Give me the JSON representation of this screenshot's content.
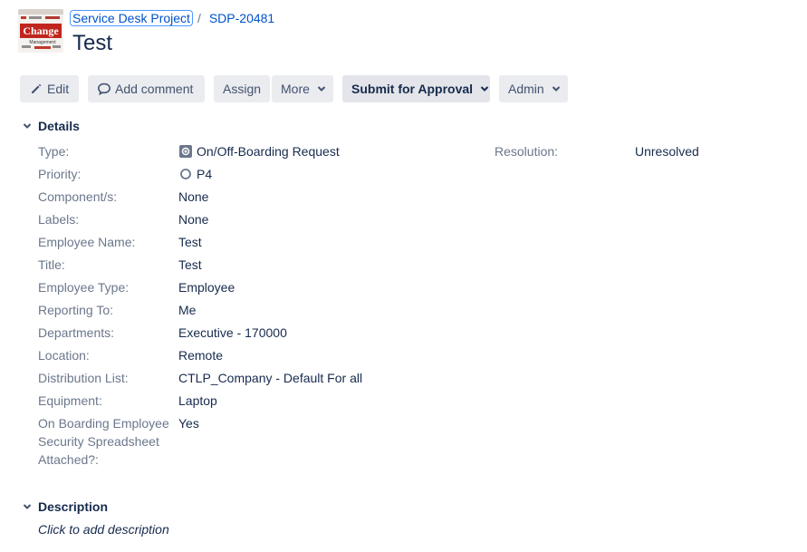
{
  "breadcrumb": {
    "project": "Service Desk Project",
    "separator": "/",
    "issue_key": "SDP-20481"
  },
  "issue": {
    "title": "Test"
  },
  "project_avatar": {
    "text_top": "Change",
    "text_bottom": "Management"
  },
  "toolbar": {
    "edit": "Edit",
    "add_comment": "Add comment",
    "assign": "Assign",
    "more": "More",
    "submit": "Submit for Approval",
    "admin": "Admin"
  },
  "details": {
    "heading": "Details",
    "fields": [
      {
        "label": "Type:",
        "value": "On/Off-Boarding Request",
        "icon": "request-type-icon"
      },
      {
        "label": "Priority:",
        "value": "P4",
        "icon": "priority-circle-icon"
      },
      {
        "label": "Component/s:",
        "value": "None"
      },
      {
        "label": "Labels:",
        "value": "None"
      },
      {
        "label": "Employee Name:",
        "value": "Test"
      },
      {
        "label": "Title:",
        "value": "Test"
      },
      {
        "label": "Employee Type:",
        "value": "Employee"
      },
      {
        "label": "Reporting To:",
        "value": "Me"
      },
      {
        "label": "Departments:",
        "value": "Executive - 170000"
      },
      {
        "label": "Location:",
        "value": "Remote"
      },
      {
        "label": "Distribution List:",
        "value": "CTLP_Company - Default For all"
      },
      {
        "label": "Equipment:",
        "value": "Laptop"
      },
      {
        "label_lines": [
          "On Boarding Employee",
          "Security Spreadsheet",
          "Attached?:"
        ],
        "value": "Yes"
      }
    ],
    "resolution_label": "Resolution:",
    "resolution_value": "Unresolved"
  },
  "description": {
    "heading": "Description",
    "placeholder": "Click to add description"
  },
  "colors": {
    "link": "#0052cc",
    "label": "#6b778c",
    "text": "#172b4d",
    "button_bg": "#ebecf0"
  }
}
